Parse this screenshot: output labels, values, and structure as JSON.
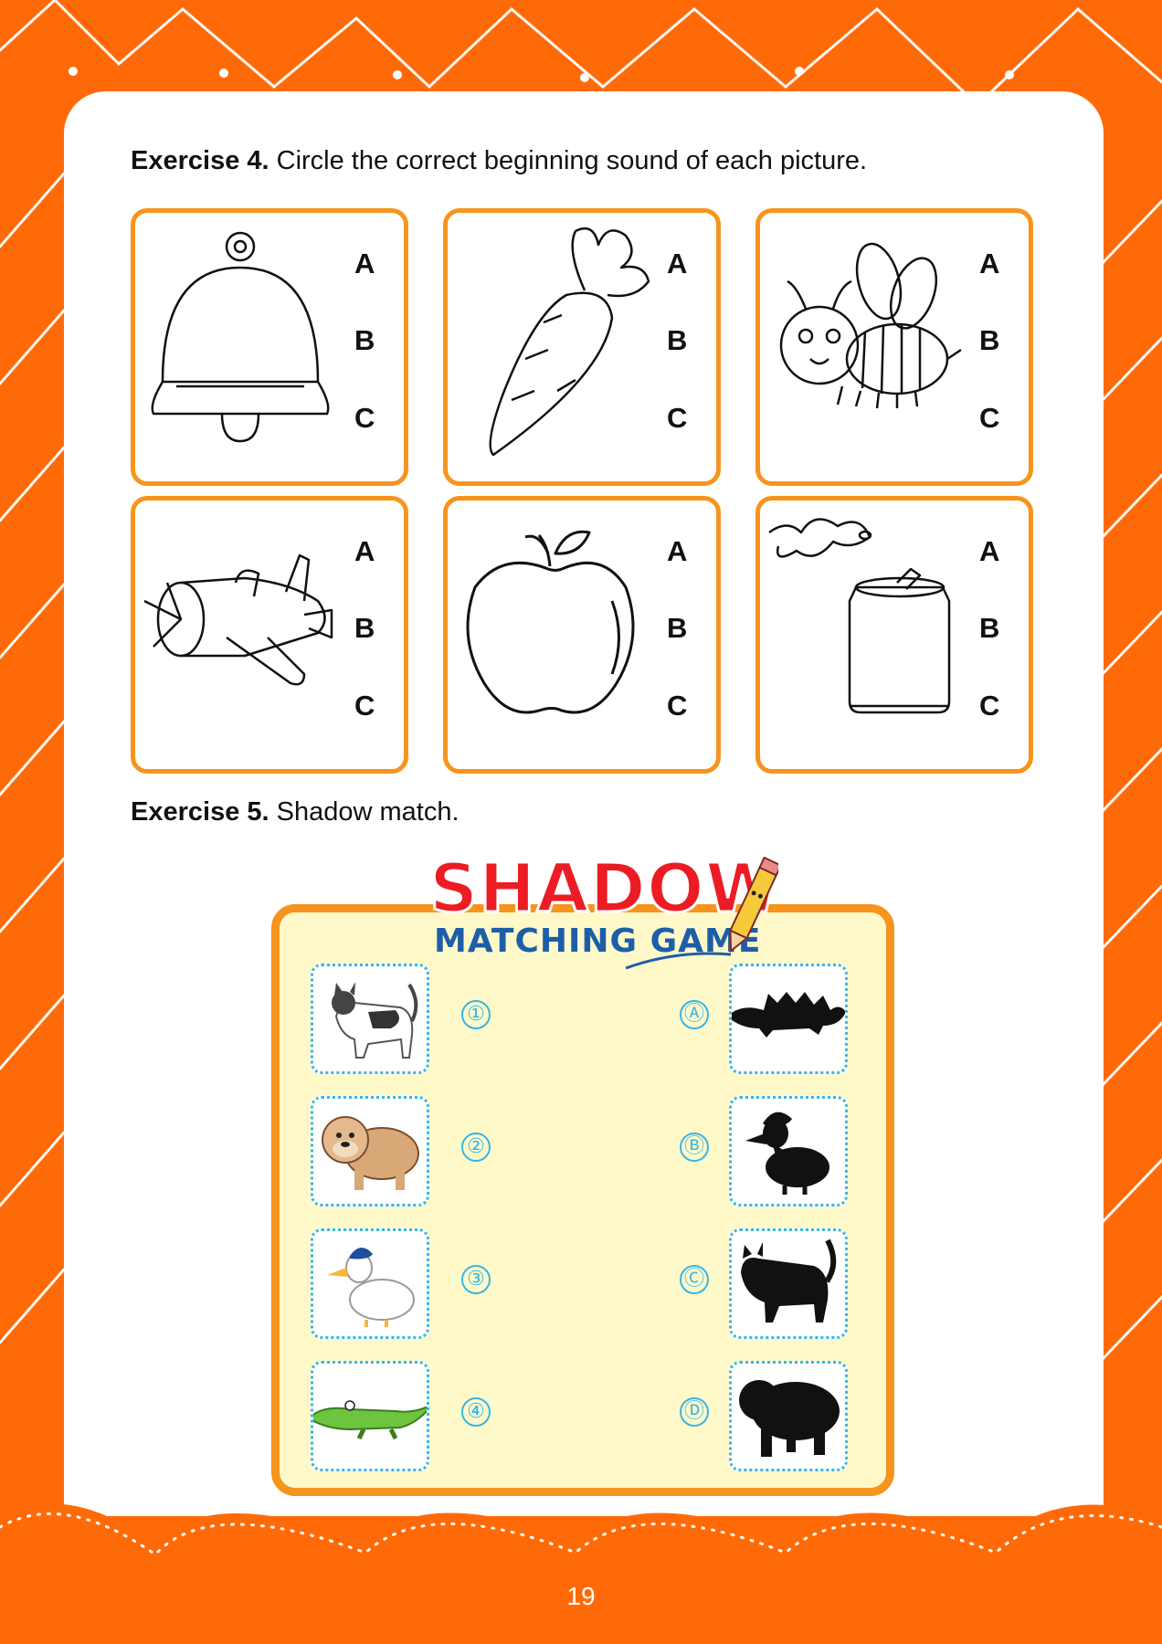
{
  "exercise4": {
    "label": "Exercise 4.",
    "instruction": "Circle the correct beginning sound of each picture.",
    "options": [
      "A",
      "B",
      "C"
    ],
    "cards": [
      {
        "picture": "bell"
      },
      {
        "picture": "carrot"
      },
      {
        "picture": "bee"
      },
      {
        "picture": "airplane"
      },
      {
        "picture": "apple"
      },
      {
        "picture": "soda-can"
      }
    ]
  },
  "exercise5": {
    "label": "Exercise 5.",
    "instruction": "Shadow match.",
    "game_title_1": "SHADOW",
    "game_title_2": "MATCHING GAME",
    "left_items": [
      {
        "number": "①",
        "picture": "cat"
      },
      {
        "number": "②",
        "picture": "bulldog"
      },
      {
        "number": "③",
        "picture": "duck"
      },
      {
        "number": "④",
        "picture": "crocodile"
      }
    ],
    "right_items": [
      {
        "letter": "Ⓐ",
        "picture": "crocodile-shadow"
      },
      {
        "letter": "Ⓑ",
        "picture": "duck-shadow"
      },
      {
        "letter": "Ⓒ",
        "picture": "cat-shadow"
      },
      {
        "letter": "Ⓓ",
        "picture": "bulldog-shadow"
      }
    ]
  },
  "page_number": "19",
  "colors": {
    "background": "#ff6a08",
    "card_border": "#f7941d",
    "board_fill": "#fff9c9",
    "badge": "#36b6e8",
    "title_red": "#ec1c24",
    "title_blue": "#1d5ea8"
  }
}
